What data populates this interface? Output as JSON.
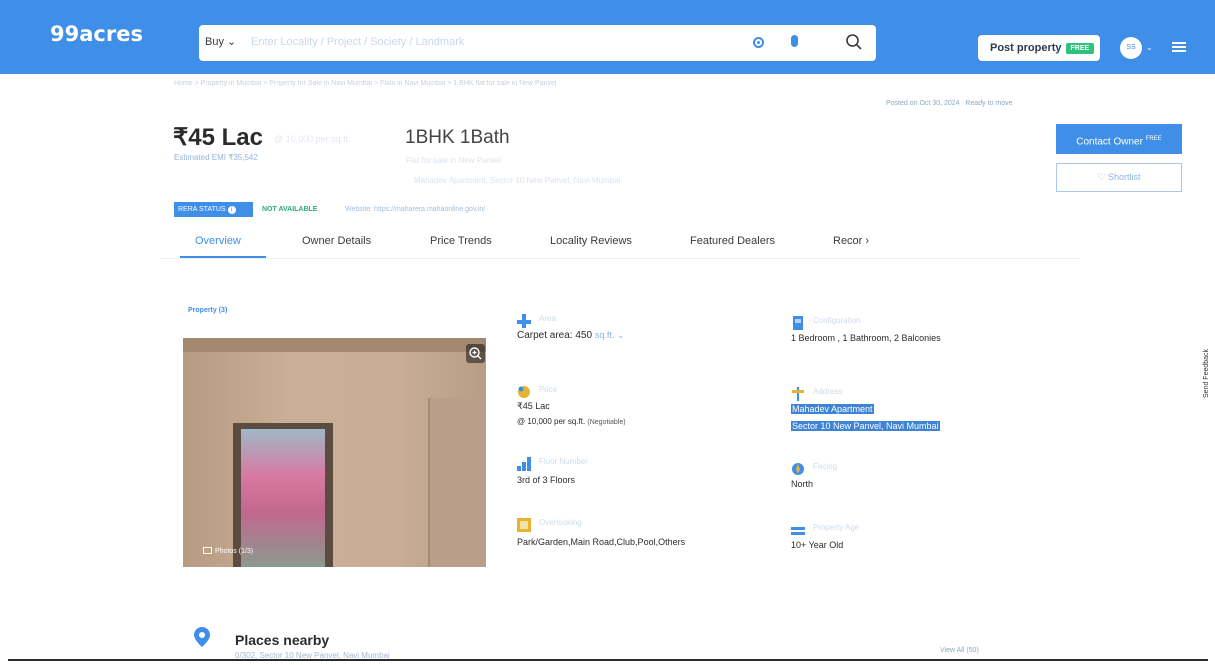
{
  "header": {
    "logo": "99acres",
    "search": {
      "buy_label": "Buy",
      "placeholder": "Enter Locality / Project / Society / Landmark"
    },
    "post_property": {
      "label": "Post property",
      "badge": "FREE"
    },
    "avatar_initials": "SS"
  },
  "breadcrumb": "Home > Property in Mumbai > Property for Sale in Navi Mumbai > Flats in Navi Mumbai > 1 BHK flat for sale in New Panvel",
  "posted": {
    "date": "Posted on Oct 30, 2024",
    "status": "Ready to move"
  },
  "listing": {
    "price": "₹45 Lac",
    "price_sub": "@ 10,000 per sq.ft.",
    "emi": "Estimated EMI ₹35,542",
    "config_title": "1BHK 1Bath",
    "config_sub": "Flat for sale in New Panvel",
    "address_sub": "Mahadev Apartment, Sector 10 New Panvel, Navi Mumbai"
  },
  "actions": {
    "contact_owner": "Contact Owner",
    "contact_badge": "FREE",
    "shortlist": "Shortlist"
  },
  "rera": {
    "badge": "RERA STATUS",
    "status": "NOT AVAILABLE",
    "website": "Website: https://maharera.mahaonline.gov.in/"
  },
  "tabs": [
    "Overview",
    "Owner Details",
    "Price Trends",
    "Locality Reviews",
    "Featured Dealers",
    "Recor"
  ],
  "property": {
    "label": "Property (3)",
    "photos_label": "Photos (1/3)"
  },
  "details": {
    "area": {
      "label": "Area",
      "value": "Carpet area: 450",
      "unit": "sq.ft."
    },
    "configuration": {
      "label": "Configuration",
      "value": "1 Bedroom , 1 Bathroom, 2 Balconies"
    },
    "price": {
      "label": "Price",
      "value": "₹45 Lac",
      "sub": "@ 10,000 per sq.ft.",
      "note": "(Negotiable)"
    },
    "address": {
      "label": "Address",
      "line1": "Mahadev Apartment",
      "line2": "Sector 10 New Panvel, Navi Mumbai"
    },
    "floor": {
      "label": "Floor Number",
      "value": "3rd of 3 Floors"
    },
    "facing": {
      "label": "Facing",
      "value": "North"
    },
    "overlooking": {
      "label": "Overlooking",
      "value": "Park/Garden,Main Road,Club,Pool,Others"
    },
    "age": {
      "label": "Property Age",
      "value": "10+ Year Old"
    }
  },
  "places_nearby": {
    "title": "Places nearby",
    "sub": "0/302, Sector 10 New Panvel, Navi Mumbai",
    "view_all": "View All (50)"
  },
  "feedback": "Send Feedback",
  "colors": {
    "brand": "#3f8ee8",
    "success": "#2eaa7a",
    "highlight": "#3f83d4"
  }
}
